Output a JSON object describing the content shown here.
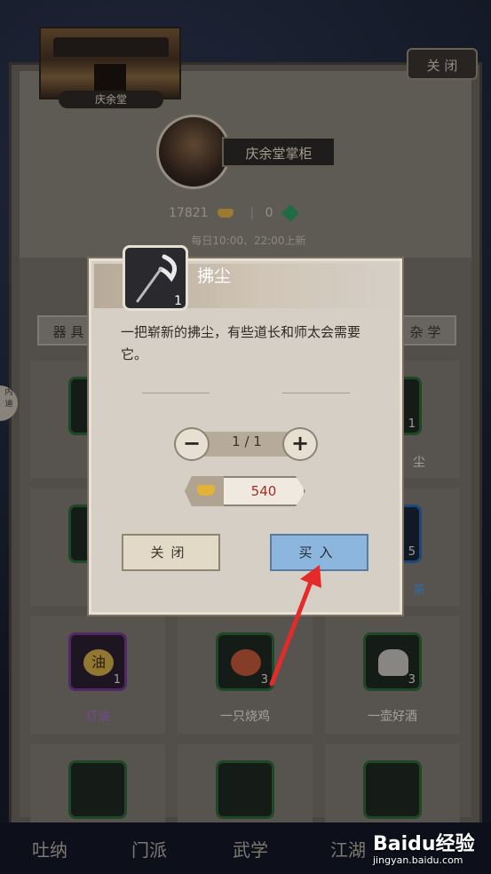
{
  "shop": {
    "name": "庆余堂",
    "close_label": "关 闭",
    "owner": "庆余堂掌柜",
    "gold": "17821",
    "jade": "0",
    "currency_separator": "|",
    "refresh_note": "每日10:00、22:00上新",
    "tab_left": "器 具",
    "tab_right": "杂 学",
    "side_pull_label": "内 迪"
  },
  "items": [
    {
      "name": "",
      "count": "",
      "border": "green"
    },
    {
      "name": "",
      "count": "",
      "border": "green"
    },
    {
      "name": "尘",
      "count": "1",
      "border": "green"
    },
    {
      "name": "",
      "count": "",
      "border": "green"
    },
    {
      "name": "",
      "count": "",
      "border": "green"
    },
    {
      "name": "茶",
      "count": "5",
      "border": "blue"
    },
    {
      "name": "灯油",
      "count": "1",
      "border": "purple",
      "glyph_text": "油"
    },
    {
      "name": "一只烧鸡",
      "count": "3",
      "border": "green"
    },
    {
      "name": "一壶好酒",
      "count": "3",
      "border": "green"
    }
  ],
  "nav": [
    "吐纳",
    "门派",
    "武学",
    "江湖"
  ],
  "modal": {
    "item_title": "拂尘",
    "item_count": "1",
    "description": "一把崭新的拂尘，有些道长和师太会需要它。",
    "quantity": "1 / 1",
    "minus": "−",
    "plus": "+",
    "price": "540",
    "close_label": "关闭",
    "buy_label": "买入"
  },
  "watermark": {
    "brand": "Baidu经验",
    "url": "jingyan.baidu.com"
  }
}
